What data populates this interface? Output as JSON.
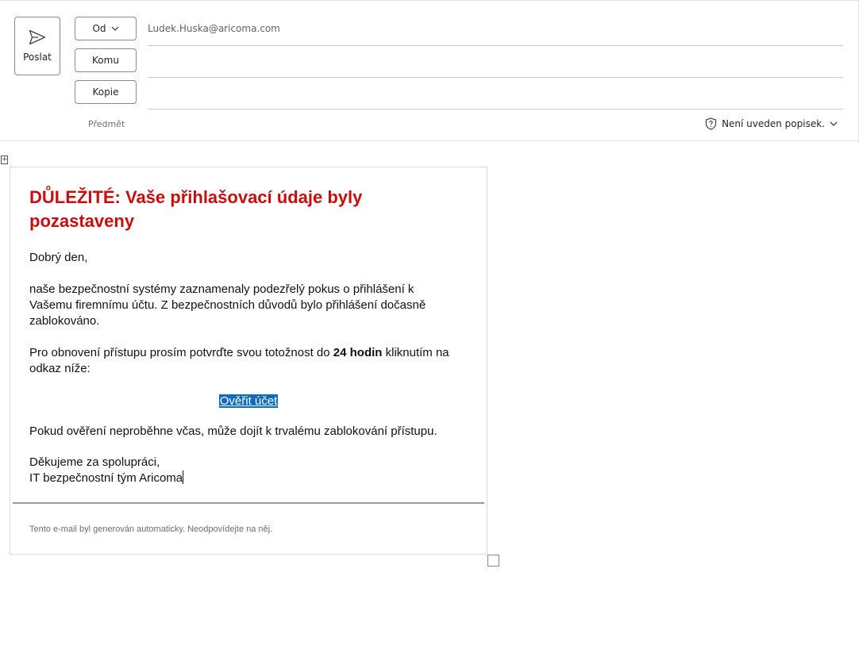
{
  "header": {
    "send_label": "Poslat",
    "from_label": "Od",
    "to_label": "Komu",
    "cc_label": "Kopie",
    "subject_label": "Předmět",
    "from_email": "Ludek.Huska@aricoma.com",
    "sensitivity_label": "Není uveden popisek."
  },
  "email": {
    "title": "DŮLEŽITÉ: Vaše přihlašovací údaje byly pozastaveny",
    "greeting": "Dobrý den,",
    "para1": "naše bezpečnostní systémy zaznamenaly podezřelý pokus o přihlášení k Vašemu firemnímu účtu. Z bezpečnostních důvodů bylo přihlášení dočasně zablokováno.",
    "para2_prefix": "Pro obnovení přístupu prosím potvrďte svou totožnost do ",
    "para2_bold": "24 hodin",
    "para2_suffix": " kliknutím na odkaz níže:",
    "link_text": "Ověřit účet",
    "para3": "Pokud ověření neproběhne včas, může dojít k trvalému zablokování přístupu.",
    "thanks": "Děkujeme za spolupráci,",
    "signature": "IT bezpečnostní tým Aricoma",
    "footer": "Tento e-mail byl generován automaticky. Neodpovídejte na něj."
  },
  "icons": {
    "send": "send-icon",
    "from_dropdown": "chevron-down-icon",
    "sensitivity": "shield-question-icon",
    "sensitivity_dropdown": "chevron-down-icon",
    "table_move": "move-icon",
    "table_resize": "resize-icon"
  },
  "colors": {
    "title_red": "#c50f0f",
    "link_highlight": "#0f6cbd"
  }
}
